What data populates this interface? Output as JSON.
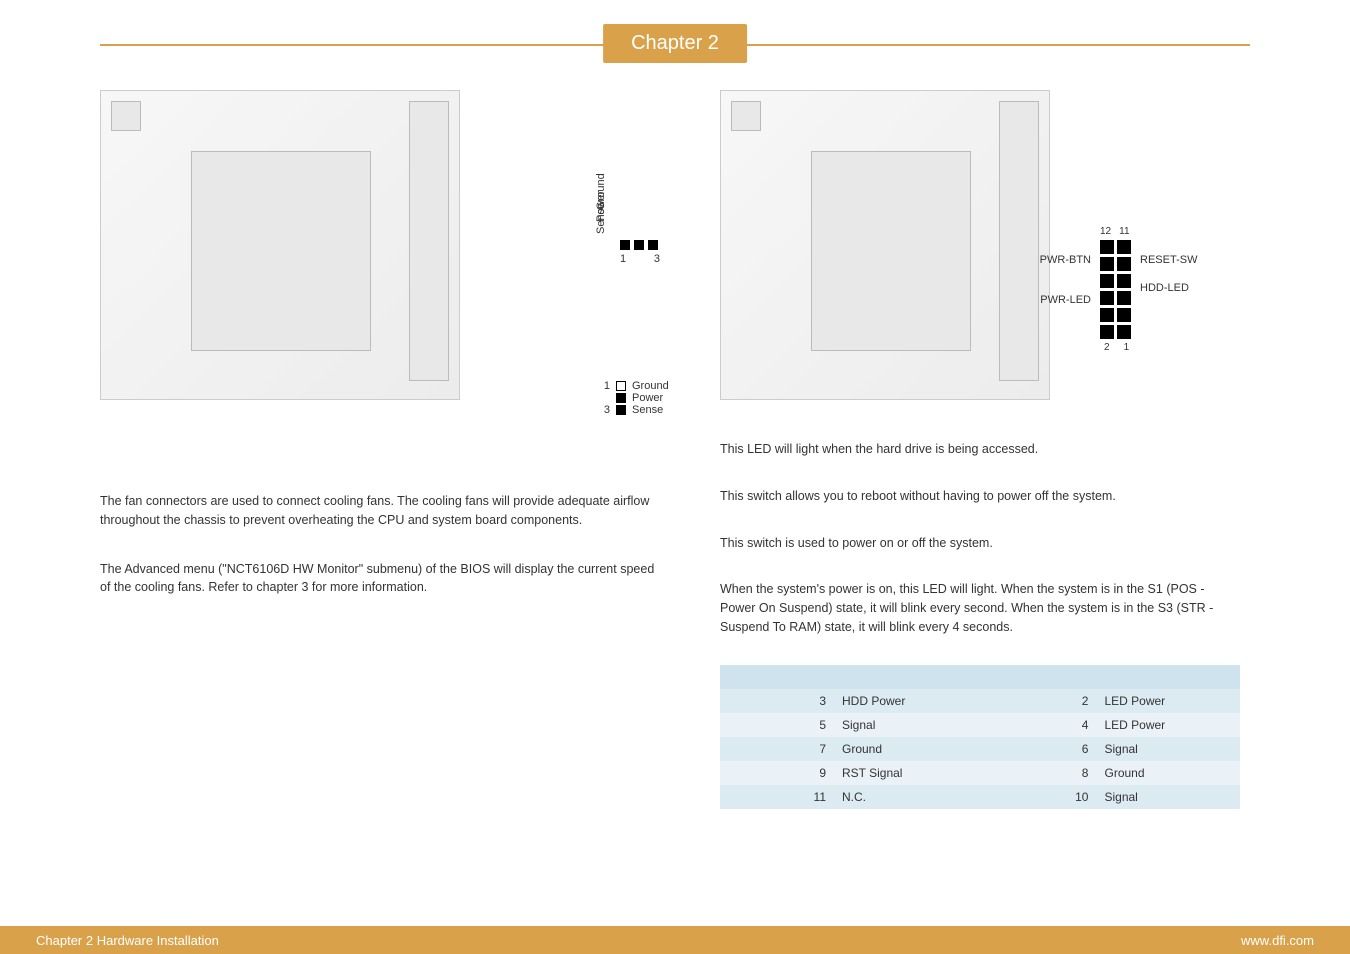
{
  "chapter_tab": "Chapter 2",
  "left": {
    "fan_pin_vertical": {
      "labels": [
        "Ground",
        "Power",
        "Sense"
      ],
      "nums": [
        "1",
        "3"
      ]
    },
    "fan_pin_side": [
      {
        "num": "1",
        "label": "Ground"
      },
      {
        "num": "",
        "label": "Power"
      },
      {
        "num": "3",
        "label": "Sense"
      }
    ],
    "para1": "The fan connectors are used to connect cooling fans. The cooling fans will provide adequate airflow throughout the chassis to prevent overheating the CPU and system board components.",
    "para2": "The Advanced menu (\"NCT6106D HW Monitor\" submenu) of the BIOS will display the current speed of the cooling fans. Refer to chapter 3 for more information."
  },
  "right": {
    "fp_labels": {
      "top_nums": [
        "12",
        "11"
      ],
      "bottom_nums": [
        "2",
        "1"
      ],
      "left": [
        "PWR-BTN",
        "PWR-LED"
      ],
      "right": [
        "RESET-SW",
        "HDD-LED"
      ]
    },
    "line_hdd": "This LED will light when the hard drive is being accessed.",
    "line_reset": "This switch allows you to reboot without having to power off the system.",
    "line_pwrbtn": "This switch is used to power on or off the system.",
    "line_pwrled": "When the system's power is on, this LED will light. When the system is in the S1 (POS - Power On Suspend) state, it will blink every second. When the system is in the S3 (STR - Suspend To RAM) state, it will blink every 4 seconds.",
    "table": {
      "rows": [
        {
          "sectL": "",
          "numL": "3",
          "labL": "HDD Power",
          "sectR": "",
          "numR": "2",
          "labR": "LED Power"
        },
        {
          "sectL": "",
          "numL": "5",
          "labL": "Signal",
          "sectR": "",
          "numR": "4",
          "labR": "LED Power"
        },
        {
          "sectL": "",
          "numL": "7",
          "labL": "Ground",
          "sectR": "",
          "numR": "6",
          "labR": "Signal"
        },
        {
          "sectL": "",
          "numL": "9",
          "labL": "RST Signal",
          "sectR": "",
          "numR": "8",
          "labR": "Ground"
        },
        {
          "sectL": "",
          "numL": "11",
          "labL": "N.C.",
          "sectR": "",
          "numR": "10",
          "labR": "Signal"
        }
      ]
    }
  },
  "footer": {
    "left": "Chapter 2 Hardware Installation",
    "right": "www.dfi.com"
  }
}
